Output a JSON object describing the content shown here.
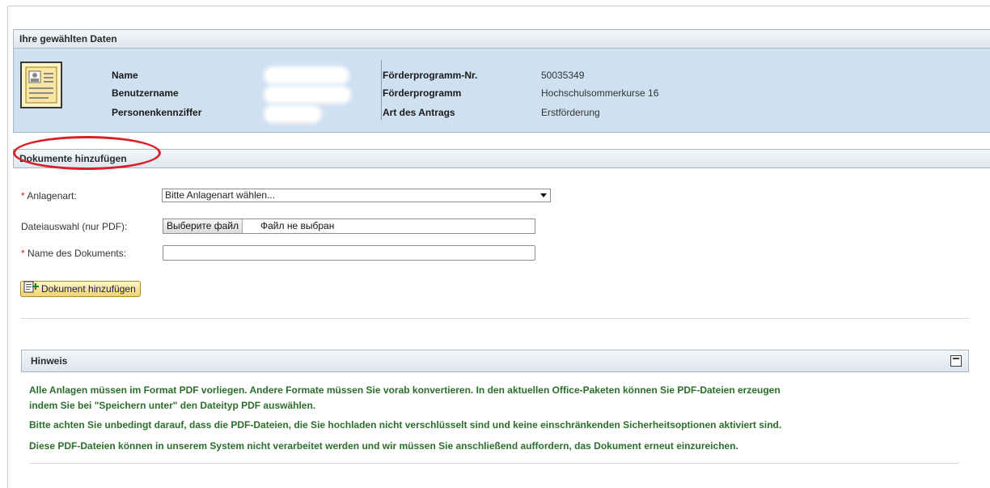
{
  "selected_data": {
    "title": "Ihre gewählten Daten",
    "labels": {
      "name": "Name",
      "username": "Benutzername",
      "personnel_number": "Personenkennziffer",
      "program_number": "Förderprogramm-Nr.",
      "program": "Förderprogramm",
      "application_type": "Art des Antrags"
    },
    "values": {
      "program_number": "50035349",
      "program": "Hochschulsommerkurse 16",
      "application_type": "Erstförderung"
    },
    "avatar_icon": "contact-card-icon"
  },
  "add_documents": {
    "title": "Dokumente hinzufügen",
    "attachment_type_label": "Anlagenart:",
    "attachment_type_value": "Bitte Anlagenart wählen...",
    "file_label": "Dateiauswahl (nur PDF):",
    "file_button": "Выберите файл",
    "file_status": "Файл не выбран",
    "doc_name_label": "Name des Dokuments:",
    "doc_name_value": "",
    "required_marker": "*",
    "add_button": "Dokument hinzufügen",
    "add_button_icon": "add-document-icon"
  },
  "hint": {
    "title": "Hinweis",
    "lines": [
      "Alle Anlagen müssen im Format PDF vorliegen. Andere Formate müssen Sie vorab konvertieren. In den aktuellen Office-Paketen können Sie PDF-Dateien erzeugen",
      "indem Sie bei \"Speichern unter\" den Dateityp PDF auswählen.",
      "Bitte achten Sie unbedingt darauf, dass die PDF-Dateien, die Sie hochladen nicht verschlüsselt sind und keine einschränkenden Sicherheitsoptionen aktiviert sind.",
      "Diese PDF-Dateien können in unserem System nicht verarbeitet werden und wir müssen Sie anschließend auffordern, das Dokument erneut einzureichen."
    ]
  },
  "colors": {
    "panel_bg": "#cfe0f0",
    "hint_text": "#2c6e2c",
    "highlight_ellipse": "#d8202a",
    "required": "#d02020"
  }
}
